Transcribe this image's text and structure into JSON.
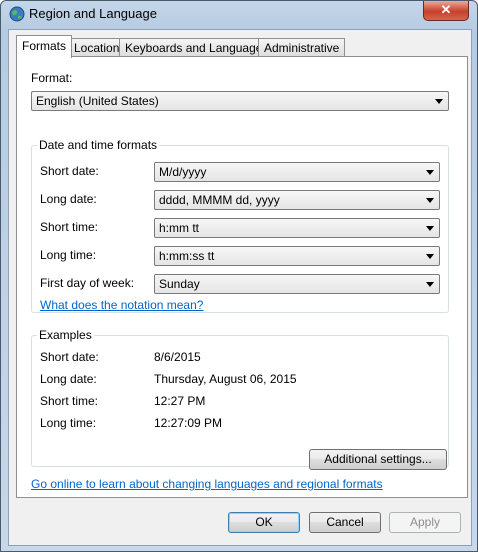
{
  "window": {
    "title": "Region and Language",
    "close_glyph": "✕"
  },
  "tabs": [
    {
      "label": "Formats"
    },
    {
      "label": "Location"
    },
    {
      "label": "Keyboards and Languages"
    },
    {
      "label": "Administrative"
    }
  ],
  "format": {
    "label": "Format:",
    "value": "English (United States)"
  },
  "date_time": {
    "group_title": "Date and time formats",
    "short_date": {
      "label": "Short date:",
      "value": "M/d/yyyy"
    },
    "long_date": {
      "label": "Long date:",
      "value": "dddd, MMMM dd, yyyy"
    },
    "short_time": {
      "label": "Short time:",
      "value": "h:mm tt"
    },
    "long_time": {
      "label": "Long time:",
      "value": "h:mm:ss tt"
    },
    "first_day": {
      "label": "First day of week:",
      "value": "Sunday"
    },
    "notation_link": "What does the notation mean?"
  },
  "examples": {
    "group_title": "Examples",
    "short_date": {
      "label": "Short date:",
      "value": "8/6/2015"
    },
    "long_date": {
      "label": "Long date:",
      "value": "Thursday, August 06, 2015"
    },
    "short_time": {
      "label": "Short time:",
      "value": "12:27 PM"
    },
    "long_time": {
      "label": "Long time:",
      "value": "12:27:09 PM"
    }
  },
  "additional_settings": "Additional settings...",
  "online_link": "Go online to learn about changing languages and regional formats",
  "buttons": {
    "ok": "OK",
    "cancel": "Cancel",
    "apply": "Apply"
  }
}
